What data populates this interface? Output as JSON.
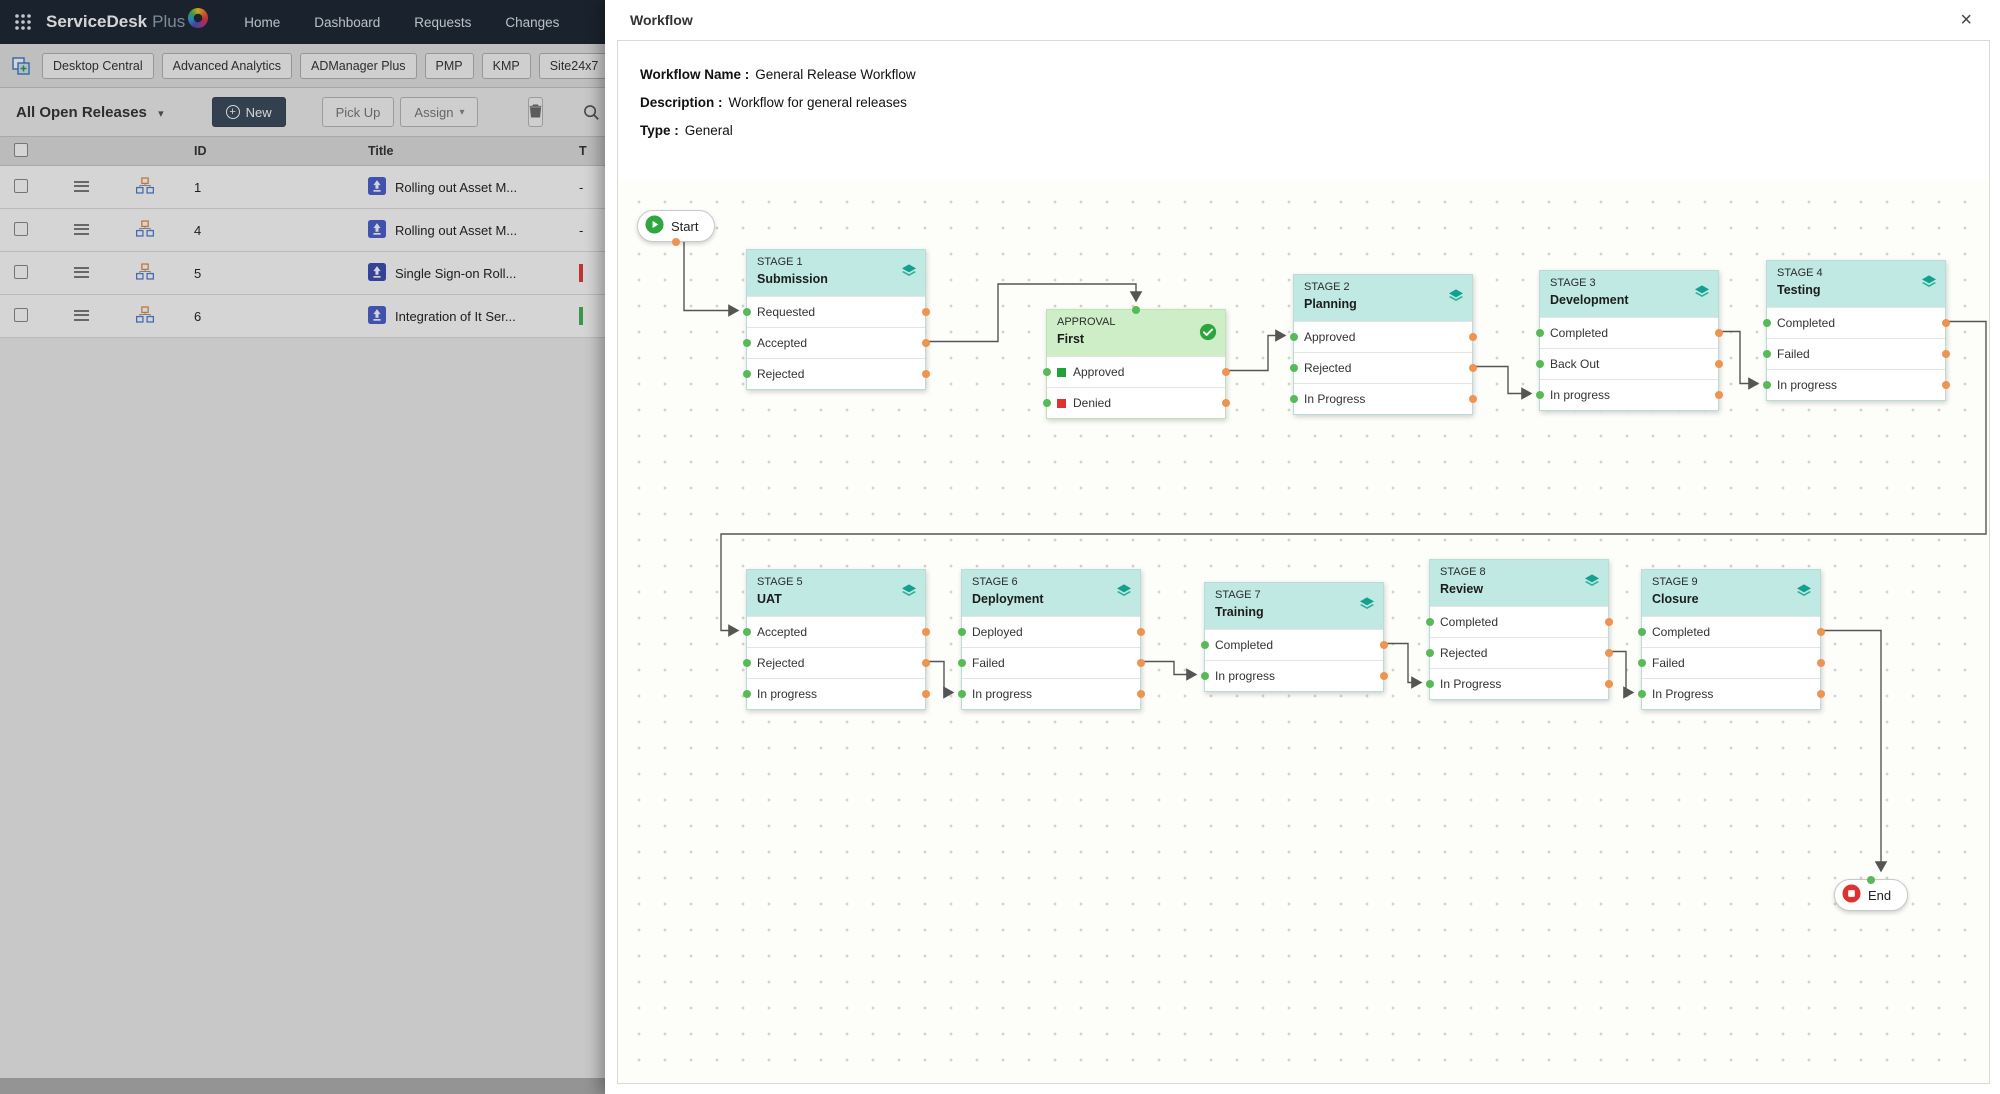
{
  "topnav": {
    "brand_primary": "ServiceDesk",
    "brand_secondary": "Plus",
    "items": [
      "Home",
      "Dashboard",
      "Requests",
      "Changes"
    ]
  },
  "tabbar": {
    "tabs": [
      "Desktop Central",
      "Advanced Analytics",
      "ADManager Plus",
      "PMP",
      "KMP",
      "Site24x7"
    ]
  },
  "toolbar": {
    "filter_label": "All Open Releases",
    "new_label": "New",
    "pickup_label": "Pick Up",
    "assign_label": "Assign"
  },
  "table": {
    "headers": {
      "id": "ID",
      "title": "Title",
      "tech": "T"
    },
    "rows": [
      {
        "id": "1",
        "title": "Rolling out Asset M...",
        "tech": "-",
        "bar_color": ""
      },
      {
        "id": "4",
        "title": "Rolling out Asset M...",
        "tech": "-",
        "bar_color": ""
      },
      {
        "id": "5",
        "title": "Single Sign-on Roll...",
        "tech": "",
        "bar_color": "#e23b3b"
      },
      {
        "id": "6",
        "title": "Integration of It Ser...",
        "tech": "",
        "bar_color": "#43b35c"
      }
    ]
  },
  "workflow": {
    "title": "Workflow",
    "close": "×",
    "info": [
      {
        "label": "Workflow Name :",
        "value": "General Release Workflow"
      },
      {
        "label": "Description :",
        "value": "Workflow for general releases"
      },
      {
        "label": "Type :",
        "value": "General"
      }
    ],
    "start_label": "Start",
    "end_label": "End",
    "nodes": [
      {
        "kind": "stage",
        "kicker": "STAGE 1",
        "name": "Submission",
        "statuses": [
          {
            "label": "Requested"
          },
          {
            "label": "Accepted"
          },
          {
            "label": "Rejected"
          }
        ]
      },
      {
        "kind": "approval",
        "kicker": "APPROVAL",
        "name": "First",
        "statuses": [
          {
            "label": "Approved",
            "bullet": "#23a039"
          },
          {
            "label": "Denied",
            "bullet": "#e03131"
          }
        ]
      },
      {
        "kind": "stage",
        "kicker": "STAGE 2",
        "name": "Planning",
        "statuses": [
          {
            "label": "Approved"
          },
          {
            "label": "Rejected"
          },
          {
            "label": "In Progress"
          }
        ]
      },
      {
        "kind": "stage",
        "kicker": "STAGE 3",
        "name": "Development",
        "statuses": [
          {
            "label": "Completed"
          },
          {
            "label": "Back Out"
          },
          {
            "label": "In progress"
          }
        ]
      },
      {
        "kind": "stage",
        "kicker": "STAGE 4",
        "name": "Testing",
        "statuses": [
          {
            "label": "Completed"
          },
          {
            "label": "Failed"
          },
          {
            "label": "In progress"
          }
        ]
      },
      {
        "kind": "stage",
        "kicker": "STAGE 5",
        "name": "UAT",
        "statuses": [
          {
            "label": "Accepted"
          },
          {
            "label": "Rejected"
          },
          {
            "label": "In progress"
          }
        ]
      },
      {
        "kind": "stage",
        "kicker": "STAGE 6",
        "name": "Deployment",
        "statuses": [
          {
            "label": "Deployed"
          },
          {
            "label": "Failed"
          },
          {
            "label": "In progress"
          }
        ]
      },
      {
        "kind": "stage",
        "kicker": "STAGE 7",
        "name": "Training",
        "statuses": [
          {
            "label": "Completed"
          },
          {
            "label": "In progress"
          }
        ]
      },
      {
        "kind": "stage",
        "kicker": "STAGE 8",
        "name": "Review",
        "statuses": [
          {
            "label": "Completed"
          },
          {
            "label": "Rejected"
          },
          {
            "label": "In Progress"
          }
        ]
      },
      {
        "kind": "stage",
        "kicker": "STAGE 9",
        "name": "Closure",
        "statuses": [
          {
            "label": "Completed"
          },
          {
            "label": "Failed"
          },
          {
            "label": "In Progress"
          }
        ]
      }
    ]
  },
  "colors": {
    "topnav_bg": "#1b2733",
    "stage_header": "#bfe9e2",
    "approval_header": "#cdeec6",
    "out_port_dot": "#ef9350",
    "in_port_dot": "#58b957",
    "connector": "#555555",
    "start_icon": "#2fa63f",
    "end_icon": "#e03131"
  }
}
